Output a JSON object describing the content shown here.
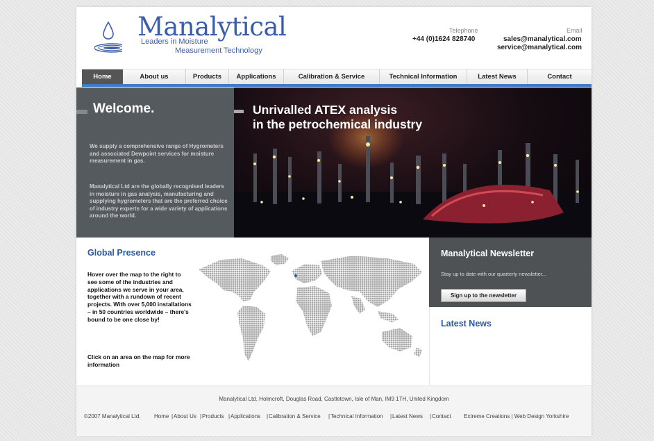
{
  "header": {
    "brand": "Manalytical",
    "tagline_line1": "Leaders in Moisture",
    "tagline_line2": "Measurement Technology",
    "telephone_label": "Telephone",
    "telephone": "+44 (0)1624 828740",
    "email_label": "Email",
    "email_sales": "sales@manalytical.com",
    "email_service": "service@manalytical.com"
  },
  "nav": {
    "active": "Home",
    "items": [
      "Home",
      "About us",
      "Products",
      "Applications",
      "Calibration & Service",
      "Technical Information",
      "Latest News",
      "Contact"
    ]
  },
  "welcome": {
    "title": "Welcome.",
    "para1": "We supply a comprehensive range of Hygrometers and associated Dewpoint services for moisture measurement in gas.",
    "para2": "Manalytical Ltd are the globally recognised leaders in moisture in gas analysis, manufacturing and supplying hygrometers that are the preferred choice of industry experts for a wide variety of applications around the world."
  },
  "hero": {
    "line1": "Unrivalled ATEX analysis",
    "line2": "in the petrochemical industry"
  },
  "global_presence": {
    "title": "Global Presence",
    "text": "Hover over the map to the right to see some of the industries and applications we serve in your area, together with a rundown of recent projects. With over 5,000 installations – in 50 countries worldwide – there's bound to be one close by!",
    "cta": "Click on an area on the map for more information"
  },
  "newsletter": {
    "title": "Manalytical Newsletter",
    "text": "Stay up to date with our quarterly newsletter...",
    "button": "Sign up to the newsletter"
  },
  "latest_news": {
    "title": "Latest News"
  },
  "footer": {
    "address": "Manalytical Ltd, Holmcroft, Douglas Road, Castletown, Isle of Man, IM9 1TH, United Kingdom",
    "copyright": "©2007 Manalytical Ltd.",
    "links": [
      "Home",
      "About Us",
      "Products",
      "Applications",
      "Calibration & Service",
      "Technical Information",
      "Latest News",
      "Contact"
    ],
    "credit": "Extreme Creations | Web Design Yorkshire"
  },
  "colors": {
    "brand_blue": "#3b5eaa",
    "heading_blue": "#2b5a9e",
    "nav_accent": "#3f7cc0",
    "panel_grey": "#555a5f"
  }
}
